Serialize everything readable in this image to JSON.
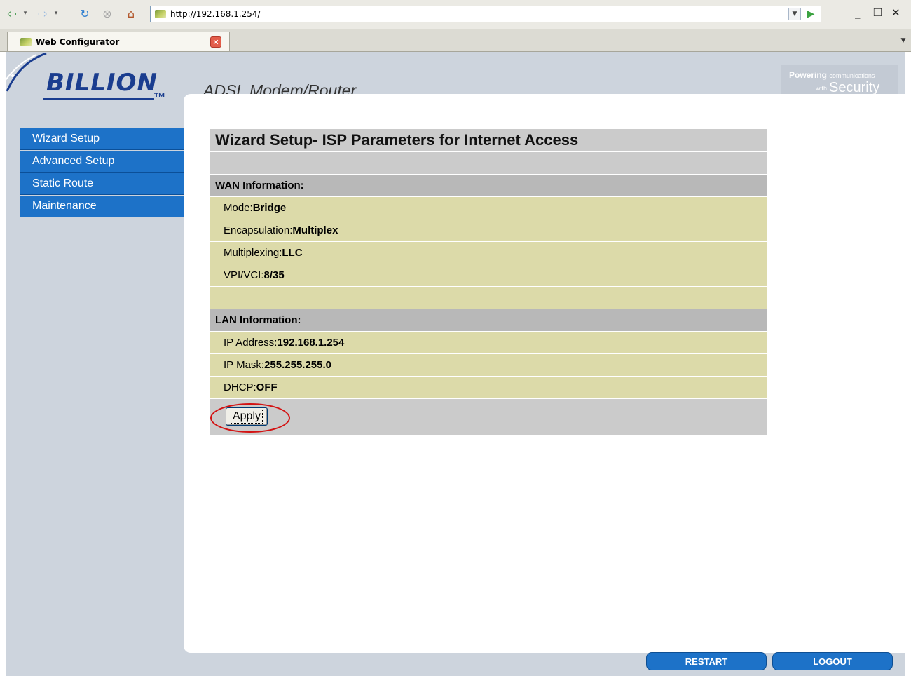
{
  "browser": {
    "url": "http://192.168.1.254/",
    "tab_title": "Web Configurator",
    "icons": [
      "back-arrow-icon",
      "forward-arrow-icon",
      "reload-icon",
      "stop-icon",
      "home-icon",
      "go-icon",
      "minimize-icon",
      "restore-icon",
      "close-icon"
    ]
  },
  "header": {
    "logo": "BILLION",
    "tm": "TM",
    "product": "ADSL Modem/Router",
    "tagline_powering": "Powering",
    "tagline_small": "communications",
    "tagline_with": "with",
    "tagline_security": "Security"
  },
  "sidebar": {
    "items": [
      {
        "label": "Wizard Setup"
      },
      {
        "label": "Advanced Setup"
      },
      {
        "label": "Static Route"
      },
      {
        "label": "Maintenance"
      }
    ]
  },
  "form": {
    "title": "Wizard Setup- ISP Parameters for Internet Access",
    "wan_heading": "WAN Information:",
    "wan": [
      {
        "label": "Mode: ",
        "value": "Bridge"
      },
      {
        "label": "Encapsulation: ",
        "value": "Multiplex"
      },
      {
        "label": "Multiplexing: ",
        "value": "LLC"
      },
      {
        "label": "VPI/VCI: ",
        "value": "8/35"
      }
    ],
    "lan_heading": "LAN Information:",
    "lan": [
      {
        "label": "IP Address: ",
        "value": "192.168.1.254"
      },
      {
        "label": "IP Mask: ",
        "value": "255.255.255.0"
      },
      {
        "label": "DHCP: ",
        "value": "OFF"
      }
    ],
    "apply_label": "Apply"
  },
  "footer": {
    "restart_label": "RESTART",
    "logout_label": "LOGOUT"
  },
  "colors": {
    "menu_blue": "#1d72c8",
    "row_tan": "#dcdaa9",
    "row_gray": "#cbcbcb",
    "highlight_red": "#d31313"
  }
}
